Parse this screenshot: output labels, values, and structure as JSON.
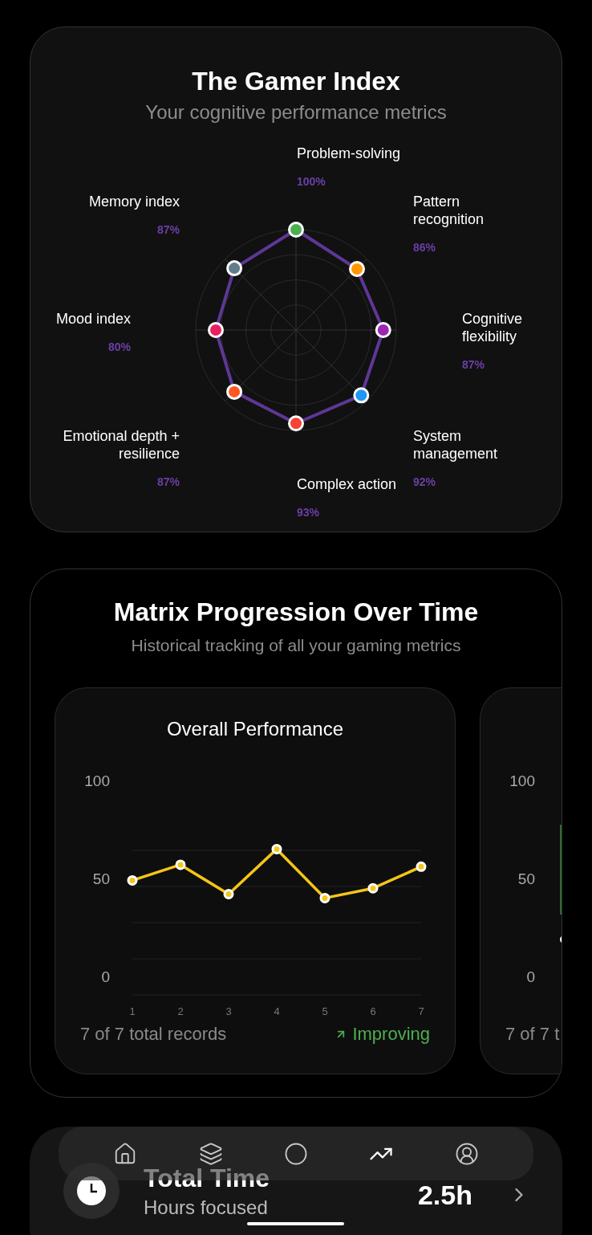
{
  "header": {
    "title": "The Gamer Index",
    "subtitle": "Your cognitive performance metrics"
  },
  "metrics": [
    {
      "label": "Problem-solving",
      "value": "100%",
      "color": "#4caf50"
    },
    {
      "label": "Memory index",
      "value": "87%",
      "color": "#607d8b"
    },
    {
      "label": "Pattern recognition",
      "value": "86%",
      "color": "#ff9800"
    },
    {
      "label": "Mood index",
      "value": "80%",
      "color": "#e91e63"
    },
    {
      "label": "Cognitive flexibility",
      "value": "87%",
      "color": "#9c27b0"
    },
    {
      "label": "Emotional depth + resilience",
      "value": "87%",
      "color": "#ff5722"
    },
    {
      "label": "System management",
      "value": "92%",
      "color": "#2196f3"
    },
    {
      "label": "Complex action",
      "value": "93%",
      "color": "#f44336"
    }
  ],
  "progression": {
    "title": "Matrix Progression Over Time",
    "subtitle": "Historical tracking of all your gaming metrics",
    "charts": [
      {
        "chart_data": {
          "type": "line",
          "title": "Overall Performance",
          "categories": [
            "1",
            "2",
            "3",
            "4",
            "5",
            "6",
            "7"
          ],
          "ylim": [
            0,
            100
          ],
          "yticks": [
            0,
            50,
            100
          ],
          "series": [
            {
              "color": "#f5c518",
              "marker": "o",
              "values": [
                49,
                57,
                42,
                65,
                40,
                45,
                56
              ]
            }
          ]
        },
        "records": "7 of 7 total records",
        "trend": "Improving"
      },
      {
        "y_labels": [
          "100",
          "50",
          "0"
        ],
        "records": "7 of 7 t"
      }
    ]
  },
  "stat": {
    "title": "Total Time",
    "subtitle": "Hours focused",
    "value": "2.5h"
  },
  "nav": [
    {
      "kind": "home",
      "selected": false
    },
    {
      "kind": "layers",
      "selected": false
    },
    {
      "kind": "circle",
      "selected": false
    },
    {
      "kind": "trend",
      "selected": true
    },
    {
      "kind": "profile",
      "selected": false
    }
  ]
}
